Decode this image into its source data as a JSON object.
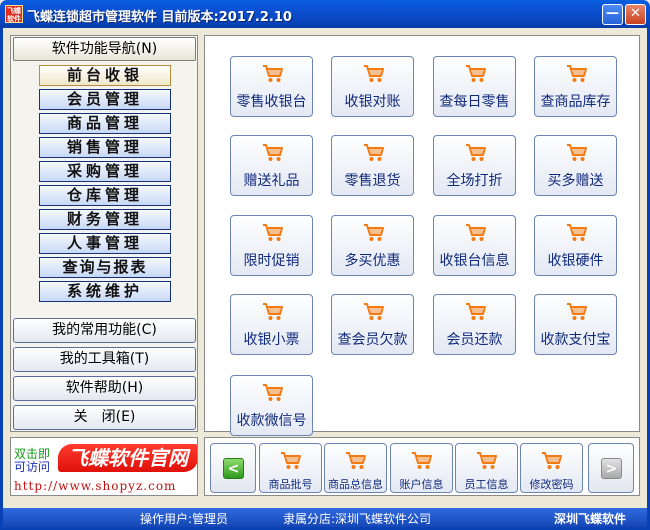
{
  "window": {
    "title": "飞蝶连锁超市管理软件  目前版本:2017.2.10",
    "logo_text": "飞蝶软件",
    "minimize_label": "—",
    "close_label": "✕"
  },
  "nav": {
    "header": "软件功能导航(N)",
    "items": [
      {
        "label": "前台收银",
        "active": true
      },
      {
        "label": "会员管理"
      },
      {
        "label": "商品管理"
      },
      {
        "label": "销售管理"
      },
      {
        "label": "采购管理"
      },
      {
        "label": "仓库管理"
      },
      {
        "label": "财务管理"
      },
      {
        "label": "人事管理"
      },
      {
        "label": "查询与报表"
      },
      {
        "label": "系统维护"
      }
    ],
    "sections": [
      {
        "label": "我的常用功能(C)"
      },
      {
        "label": "我的工具箱(T)"
      },
      {
        "label": "软件帮助(H)"
      },
      {
        "label": "关　闭(E)"
      }
    ]
  },
  "logo": {
    "side_line1": "双击即",
    "side_line2": "可访问",
    "brand": "飞蝶软件官网",
    "url": "http://www.shopyz.com"
  },
  "tiles": [
    {
      "label": "零售收银台"
    },
    {
      "label": "收银对账"
    },
    {
      "label": "查每日零售"
    },
    {
      "label": "查商品库存"
    },
    {
      "label": "赠送礼品"
    },
    {
      "label": "零售退货"
    },
    {
      "label": "全场打折"
    },
    {
      "label": "买多赠送"
    },
    {
      "label": "限时促销"
    },
    {
      "label": "多买优惠"
    },
    {
      "label": "收银台信息"
    },
    {
      "label": "收银硬件"
    },
    {
      "label": "收银小票"
    },
    {
      "label": "查会员欠款"
    },
    {
      "label": "会员还款"
    },
    {
      "label": "收款支付宝"
    },
    {
      "label": "收款微信号"
    }
  ],
  "toolbar": {
    "prev_label": "<",
    "next_label": ">",
    "items": [
      {
        "label": "商品批号"
      },
      {
        "label": "商品总信息"
      },
      {
        "label": "账户信息"
      },
      {
        "label": "员工信息"
      },
      {
        "label": "修改密码"
      }
    ]
  },
  "status": {
    "operator": "操作用户:管理员",
    "store": "隶属分店:深圳飞蝶软件公司",
    "company": "深圳飞蝶软件"
  },
  "colors": {
    "title_bar": "#0B4FD0",
    "tile_text": "#102A7C",
    "cart_orange": "#F47A12",
    "brand_red": "#E0100A",
    "status_bar": "#1646B4"
  },
  "icons": {
    "tile_icon": "shopping-cart-icon",
    "prev_icon": "arrow-left-icon",
    "next_icon": "arrow-right-icon"
  }
}
